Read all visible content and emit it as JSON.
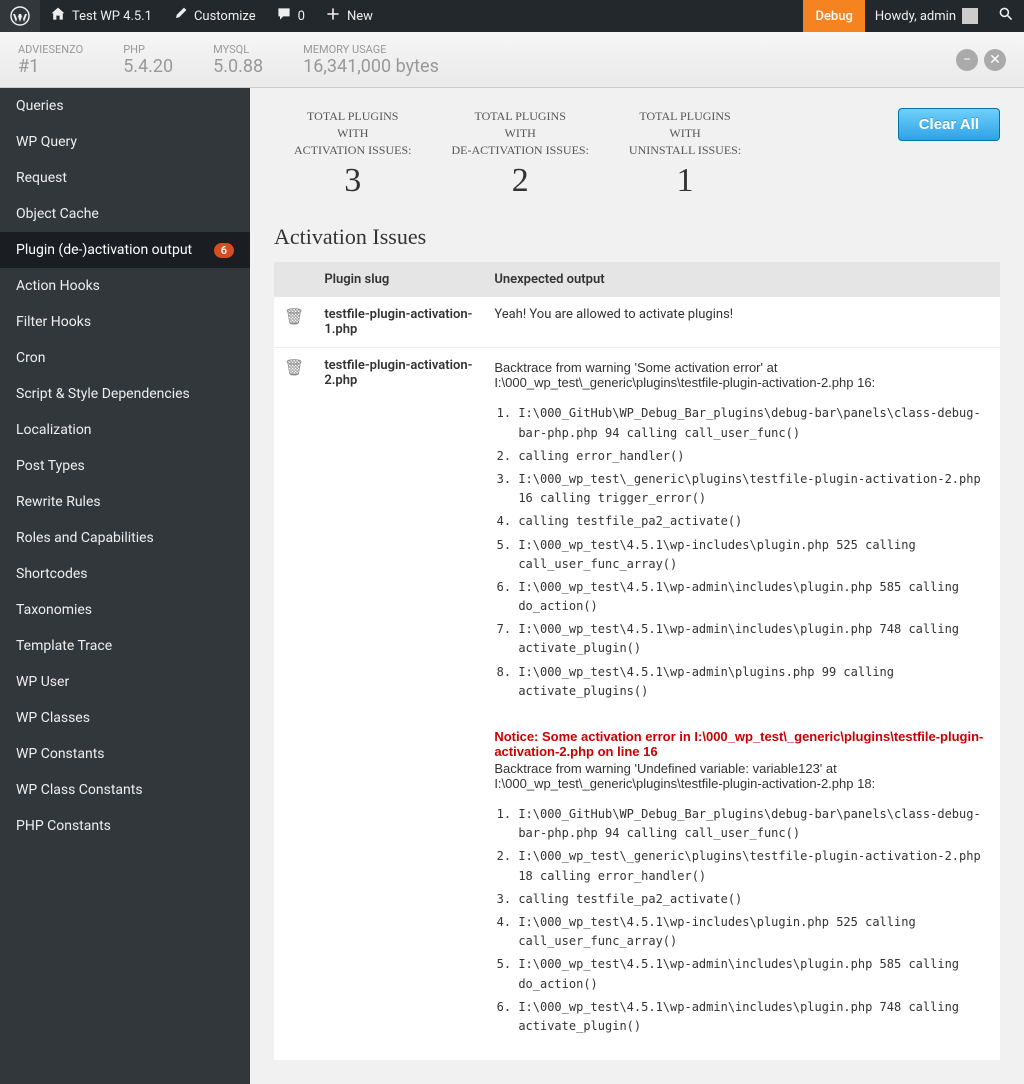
{
  "adminbar": {
    "site_title": "Test WP 4.5.1",
    "customize": "Customize",
    "comments": "0",
    "new": "New",
    "debug": "Debug",
    "howdy": "Howdy, admin"
  },
  "debugbar": {
    "metrics": [
      {
        "label": "ADVIESENZO",
        "value": "#1"
      },
      {
        "label": "PHP",
        "value": "5.4.20"
      },
      {
        "label": "MySQL",
        "value": "5.0.88"
      },
      {
        "label": "Memory Usage",
        "value": "16,341,000 bytes"
      }
    ]
  },
  "sidebar": {
    "items": [
      {
        "label": "Queries"
      },
      {
        "label": "WP Query"
      },
      {
        "label": "Request"
      },
      {
        "label": "Object Cache"
      },
      {
        "label": "Plugin (de-)activation output",
        "badge": "6",
        "active": true
      },
      {
        "label": "Action Hooks"
      },
      {
        "label": "Filter Hooks"
      },
      {
        "label": "Cron"
      },
      {
        "label": "Script & Style Dependencies"
      },
      {
        "label": "Localization"
      },
      {
        "label": "Post Types"
      },
      {
        "label": "Rewrite Rules"
      },
      {
        "label": "Roles and Capabilities"
      },
      {
        "label": "Shortcodes"
      },
      {
        "label": "Taxonomies"
      },
      {
        "label": "Template Trace"
      },
      {
        "label": "WP User"
      },
      {
        "label": "WP Classes"
      },
      {
        "label": "WP Constants"
      },
      {
        "label": "WP Class Constants"
      },
      {
        "label": "PHP Constants"
      }
    ]
  },
  "stats": [
    {
      "line1": "TOTAL PLUGINS",
      "line2": "WITH",
      "line3": "ACTIVATION ISSUES:",
      "value": "3"
    },
    {
      "line1": "TOTAL PLUGINS",
      "line2": "WITH",
      "line3": "DE-ACTIVATION ISSUES:",
      "value": "2"
    },
    {
      "line1": "TOTAL PLUGINS",
      "line2": "WITH",
      "line3": "UNINSTALL ISSUES:",
      "value": "1"
    }
  ],
  "clear_all": "Clear All",
  "section_title": "Activation Issues",
  "table": {
    "headers": {
      "slug": "Plugin slug",
      "output": "Unexpected output"
    },
    "rows": [
      {
        "slug": "testfile-plugin-activation-1.php",
        "simple_output": "Yeah! You are allowed to activate plugins!"
      },
      {
        "slug": "testfile-plugin-activation-2.php",
        "intro1": "Backtrace from warning 'Some activation error' at I:\\000_wp_test\\_generic\\plugins\\testfile-plugin-activation-2.php 16:",
        "trace1": [
          "I:\\000_GitHub\\WP_Debug_Bar_plugins\\debug-bar\\panels\\class-debug-bar-php.php 94 calling call_user_func()",
          "calling error_handler()",
          "I:\\000_wp_test\\_generic\\plugins\\testfile-plugin-activation-2.php 16 calling trigger_error()",
          "calling testfile_pa2_activate()",
          "I:\\000_wp_test\\4.5.1\\wp-includes\\plugin.php 525 calling call_user_func_array()",
          "I:\\000_wp_test\\4.5.1\\wp-admin\\includes\\plugin.php 585 calling do_action()",
          "I:\\000_wp_test\\4.5.1\\wp-admin\\includes\\plugin.php 748 calling activate_plugin()",
          "I:\\000_wp_test\\4.5.1\\wp-admin\\plugins.php 99 calling activate_plugins()"
        ],
        "notice_prefix": "Notice",
        "notice_mid": ": Some activation error in ",
        "notice_path": "I:\\000_wp_test\\_generic\\plugins\\testfile-plugin-activation-2.php",
        "notice_online": " on line ",
        "notice_line": "16",
        "intro2": "Backtrace from warning 'Undefined variable: variable123' at I:\\000_wp_test\\_generic\\plugins\\testfile-plugin-activation-2.php 18:",
        "trace2": [
          "I:\\000_GitHub\\WP_Debug_Bar_plugins\\debug-bar\\panels\\class-debug-bar-php.php 94 calling call_user_func()",
          "I:\\000_wp_test\\_generic\\plugins\\testfile-plugin-activation-2.php 18 calling error_handler()",
          "calling testfile_pa2_activate()",
          "I:\\000_wp_test\\4.5.1\\wp-includes\\plugin.php 525 calling call_user_func_array()",
          "I:\\000_wp_test\\4.5.1\\wp-admin\\includes\\plugin.php 585 calling do_action()",
          "I:\\000_wp_test\\4.5.1\\wp-admin\\includes\\plugin.php 748 calling activate_plugin()"
        ]
      }
    ]
  }
}
